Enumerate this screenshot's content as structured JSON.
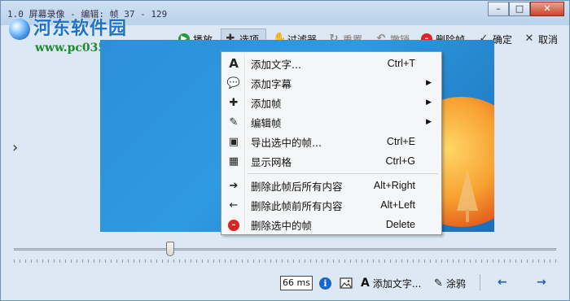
{
  "window": {
    "title": "1.0 屏幕录像 - 编辑: 帧 37 - 129",
    "watermark_logo": "河东软件园",
    "watermark_url": "www.pc0359.cn",
    "controls": {
      "minimize": "–",
      "maximize": "□",
      "close": "✕"
    }
  },
  "toolbar": {
    "play": "播放",
    "options": "选项",
    "filter": "过滤器",
    "reset": "重置",
    "undo": "撤销",
    "delete_frame": "删除帧",
    "ok": "确定",
    "cancel": "取消"
  },
  "menu": {
    "items": [
      {
        "icon": "A",
        "label": "添加文字...",
        "shortcut": "Ctrl+T",
        "submenu": false
      },
      {
        "icon": "💬",
        "label": "添加字幕",
        "shortcut": "",
        "submenu": true
      },
      {
        "icon": "✚",
        "label": "添加帧",
        "shortcut": "",
        "submenu": true
      },
      {
        "icon": "✎",
        "label": "编辑帧",
        "shortcut": "",
        "submenu": true
      },
      {
        "icon": "▣",
        "label": "导出选中的帧...",
        "shortcut": "Ctrl+E",
        "submenu": false
      },
      {
        "icon": "▦",
        "label": "显示网格",
        "shortcut": "Ctrl+G",
        "submenu": false
      },
      {
        "icon": "➔",
        "label": "删除此帧后所有内容",
        "shortcut": "Alt+Right",
        "submenu": false
      },
      {
        "icon": "←",
        "label": "删除此帧前所有内容",
        "shortcut": "Alt+Left",
        "submenu": false
      },
      {
        "icon": "–",
        "label": "删除选中的帧",
        "shortcut": "Delete",
        "submenu": false
      }
    ],
    "submenu_arrow": "▶"
  },
  "statusbar": {
    "delay": "66 ms",
    "add_text": "添加文字...",
    "paint": "涂鸦"
  },
  "colors": {
    "accent": "#1e72c7",
    "play_green": "#2a9a3a",
    "delete_red": "#dd2222"
  }
}
